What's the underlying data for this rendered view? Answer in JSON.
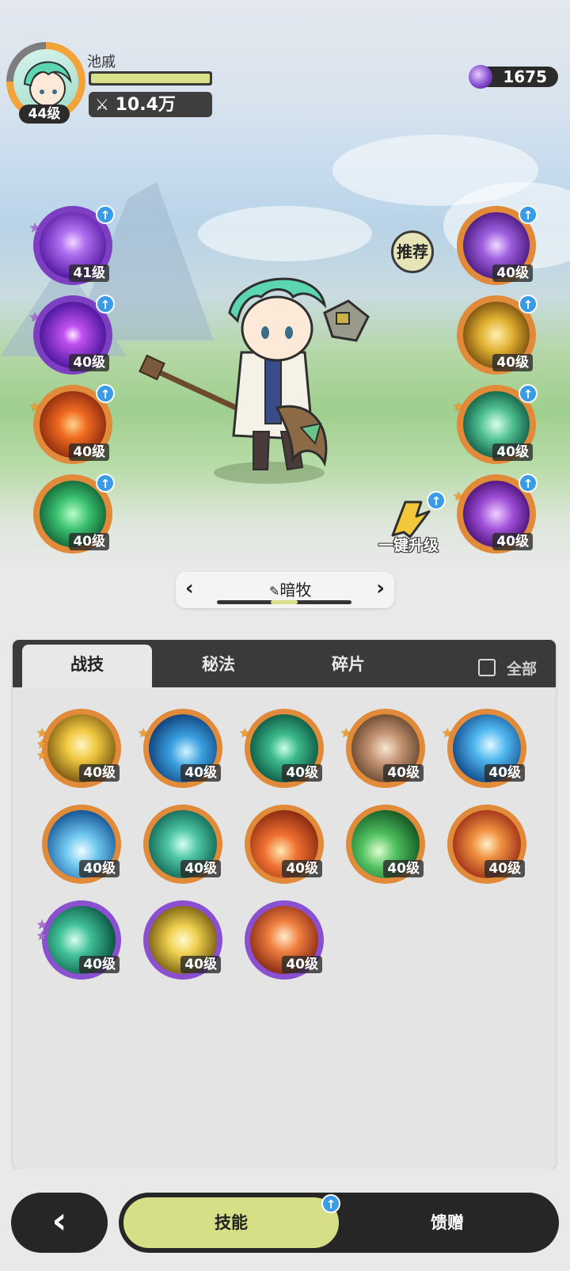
{
  "player": {
    "name": "池戚",
    "level": "44级",
    "power": "10.4万"
  },
  "currency": {
    "amount": "1675",
    "icon": "purple-gem-icon"
  },
  "equipped_left": [
    {
      "level": "41级",
      "icon": "purple-sparkle-skill-icon",
      "stars": 1,
      "star_color": "purple"
    },
    {
      "level": "40级",
      "icon": "purple-eye-skill-icon",
      "stars": 1,
      "star_color": "purple"
    },
    {
      "level": "40级",
      "icon": "fire-swirl-skill-icon",
      "stars": 1,
      "star_color": "orange"
    },
    {
      "level": "40级",
      "icon": "green-heal-cross-skill-icon",
      "stars": 0
    }
  ],
  "equipped_right": [
    {
      "level": "40级",
      "icon": "purple-eye-sigil-skill-icon",
      "stars": 0
    },
    {
      "level": "40级",
      "icon": "golden-wing-skill-icon",
      "stars": 0
    },
    {
      "level": "40级",
      "icon": "green-shield-skill-icon",
      "stars": 1,
      "star_color": "orange"
    },
    {
      "level": "40级",
      "icon": "purple-spiral-skill-icon",
      "stars": 1,
      "star_color": "orange"
    }
  ],
  "recommend_label": "推荐",
  "one_click_upgrade": "一键升级",
  "job": {
    "name": "暗牧"
  },
  "tabs": [
    "战技",
    "秘法",
    "碎片"
  ],
  "all_label": "全部",
  "grid_skills": [
    {
      "level": "40级",
      "icon": "golden-crystal-skill-icon",
      "stars": 3
    },
    {
      "level": "40级",
      "icon": "blue-wave-skill-icon",
      "stars": 1
    },
    {
      "level": "40级",
      "icon": "green-thorn-skill-icon",
      "stars": 1
    },
    {
      "level": "40级",
      "icon": "rock-fist-skill-icon",
      "stars": 1
    },
    {
      "level": "40级",
      "icon": "ice-shard-skill-icon",
      "stars": 1
    },
    {
      "level": "40级",
      "icon": "ice-burst-skill-icon",
      "stars": 0
    },
    {
      "level": "40级",
      "icon": "wind-vortex-skill-icon",
      "stars": 0
    },
    {
      "level": "40级",
      "icon": "fireball-skill-icon",
      "stars": 0
    },
    {
      "level": "40级",
      "icon": "green-arrow-skill-icon",
      "stars": 0
    },
    {
      "level": "40级",
      "icon": "flame-orb-skill-icon",
      "stars": 0
    },
    {
      "level": "40级",
      "icon": "green-feather-skill-icon",
      "stars": 2
    },
    {
      "level": "40级",
      "icon": "holy-light-skill-icon",
      "stars": 0
    },
    {
      "level": "40级",
      "icon": "fire-wolf-skill-icon",
      "stars": 0
    }
  ],
  "bottom_nav": {
    "back_icon": "back-arrow-icon",
    "skills": "技能",
    "gift": "馈赠"
  }
}
